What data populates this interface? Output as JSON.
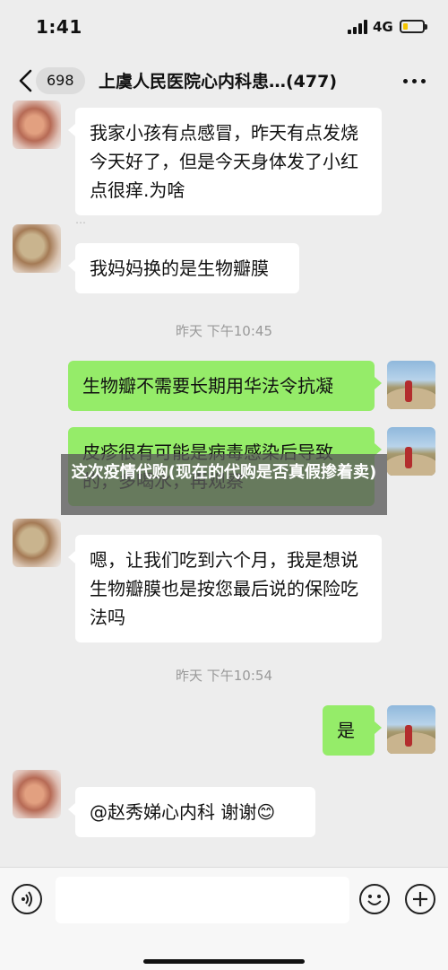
{
  "status_bar": {
    "time": "1:41",
    "network": "4G",
    "battery_level": 0.25
  },
  "nav": {
    "back_icon": "chevron-left-icon",
    "unread_count": "698",
    "title": "上虞人民医院心内科患…(477)",
    "more_icon": "more-dots-icon"
  },
  "messages": [
    {
      "side": "left",
      "text": "我家小孩有点感冒，昨天有点发烧今天好了，但是今天身体发了小红点很痒.为啥"
    },
    {
      "side": "left",
      "text": "我妈妈换的是生物瓣膜"
    },
    {
      "type": "time",
      "text": "昨天 下午10:45"
    },
    {
      "side": "right",
      "text": "生物瓣不需要长期用华法令抗凝"
    },
    {
      "side": "right",
      "text": "皮疹很有可能是病毒感染后导致的，多喝水，再观察"
    },
    {
      "side": "left",
      "text": "嗯，让我们吃到六个月，我是想说生物瓣膜也是按您最后说的保险吃法吗"
    },
    {
      "type": "time",
      "text": "昨天 下午10:54"
    },
    {
      "side": "right",
      "text": "是"
    },
    {
      "side": "left",
      "text": "@赵秀娣心内科 谢谢😊"
    }
  ],
  "watermark": {
    "text": "这次疫情代购(现在的代购是否真假掺着卖)"
  },
  "input_bar": {
    "voice_icon": "voice-icon",
    "emoji_icon": "emoji-icon",
    "plus_icon": "plus-icon",
    "input_value": ""
  },
  "colors": {
    "background": "#ededed",
    "bubble_right": "#95ec69",
    "bubble_left": "#ffffff",
    "battery": "#f5c500"
  }
}
